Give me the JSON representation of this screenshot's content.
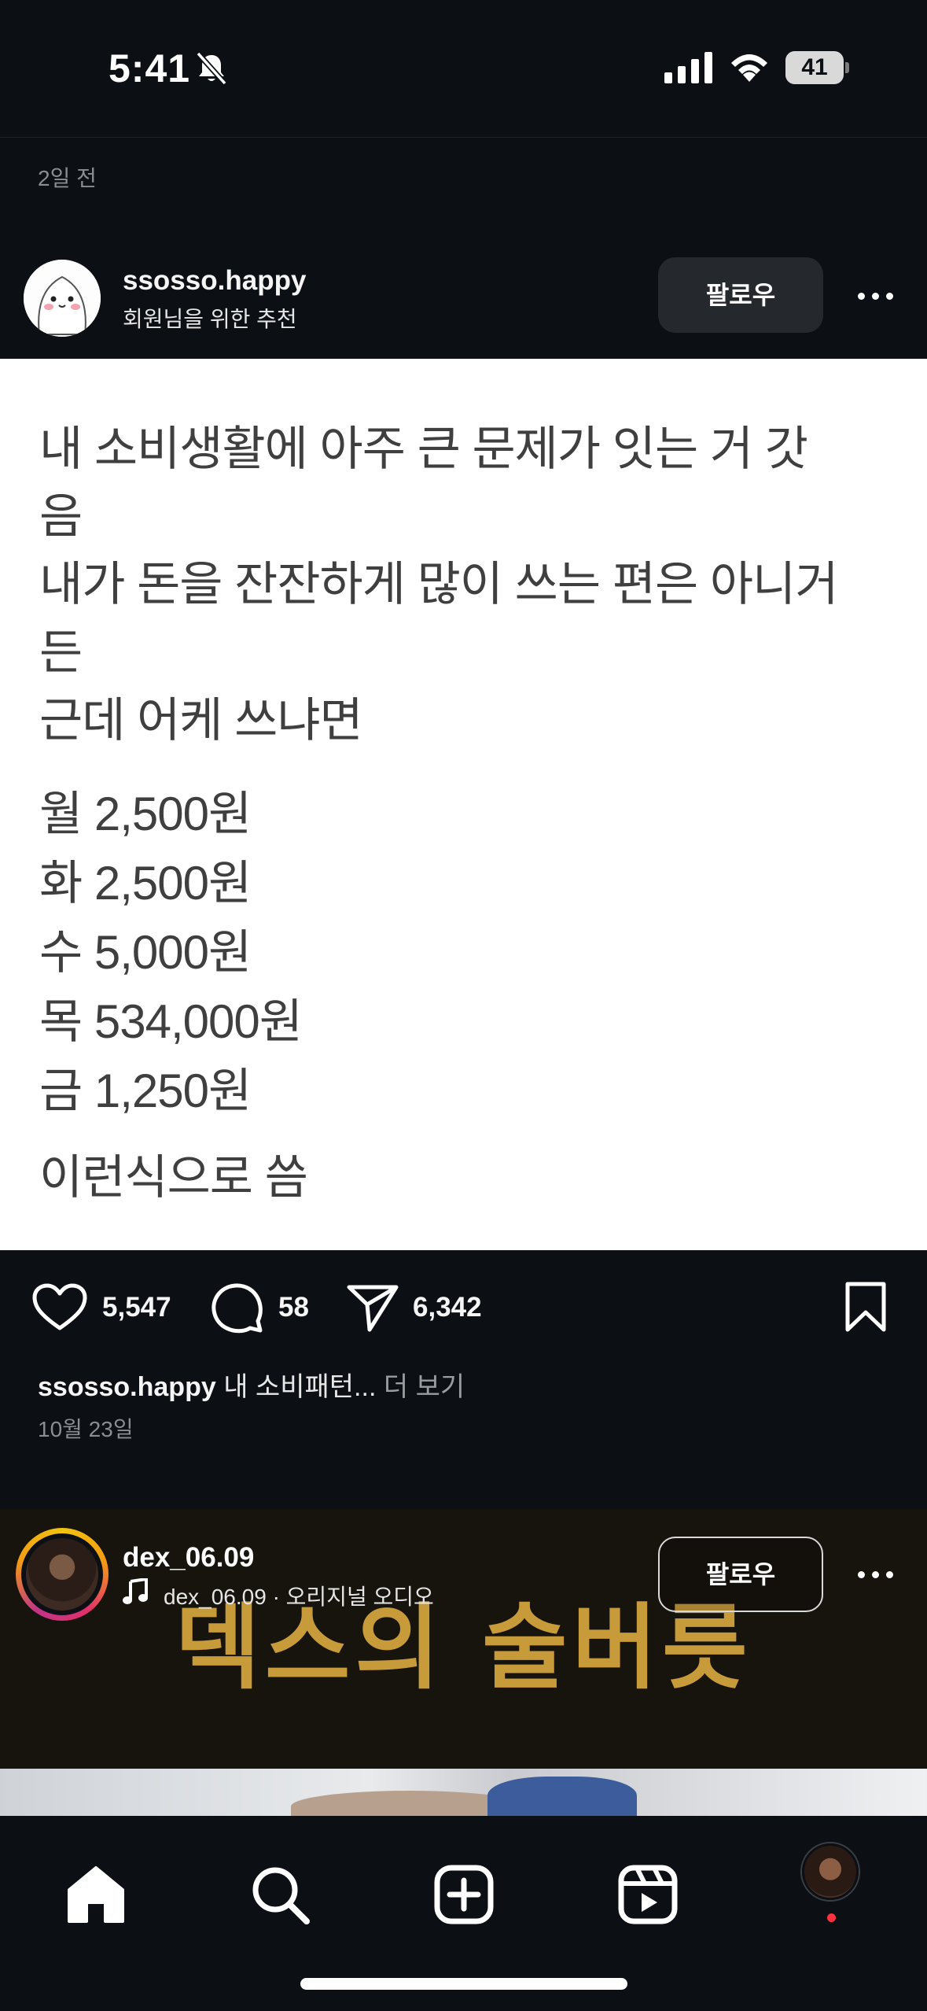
{
  "status_bar": {
    "time": "5:41",
    "battery_percent": "41",
    "battery_level": 0.41
  },
  "previous_post": {
    "time_ago": "2일 전"
  },
  "post1": {
    "username": "ssosso.happy",
    "subtitle": "회원님을 위한 추천",
    "follow_label": "팔로우",
    "image_text": [
      "내 소비생활에 아주 큰 문제가 잇는 거 갓",
      "음",
      "내가 돈을 잔잔하게 많이 쓰는 편은 아니거",
      "든",
      "근데 어케 쓰냐면",
      "월 2,500원",
      "화 2,500원",
      "수 5,000원",
      "목 534,000원",
      "금 1,250원",
      "이런식으로 씀"
    ],
    "likes": "5,547",
    "comments": "58",
    "shares": "6,342",
    "caption_user": "ssosso.happy",
    "caption_text": "내 소비패턴...",
    "caption_more": "더 보기",
    "date": "10월 23일"
  },
  "post2": {
    "username": "dex_06.09",
    "audio": "dex_06.09 · 오리지널 오디오",
    "follow_label": "팔로우",
    "headline": "덱스의 술버릇"
  },
  "colors": {
    "background": "#0c1015",
    "story_ring_start": "#f1c40f",
    "story_ring_end": "#c13584",
    "notification_dot": "#ff3040",
    "reel_headline": "#c79a3a"
  },
  "icons": {
    "nav": [
      "home-icon",
      "search-icon",
      "create-icon",
      "reels-icon",
      "profile-avatar"
    ],
    "actions": [
      "heart-icon",
      "comment-icon",
      "share-icon",
      "bookmark-icon"
    ]
  }
}
